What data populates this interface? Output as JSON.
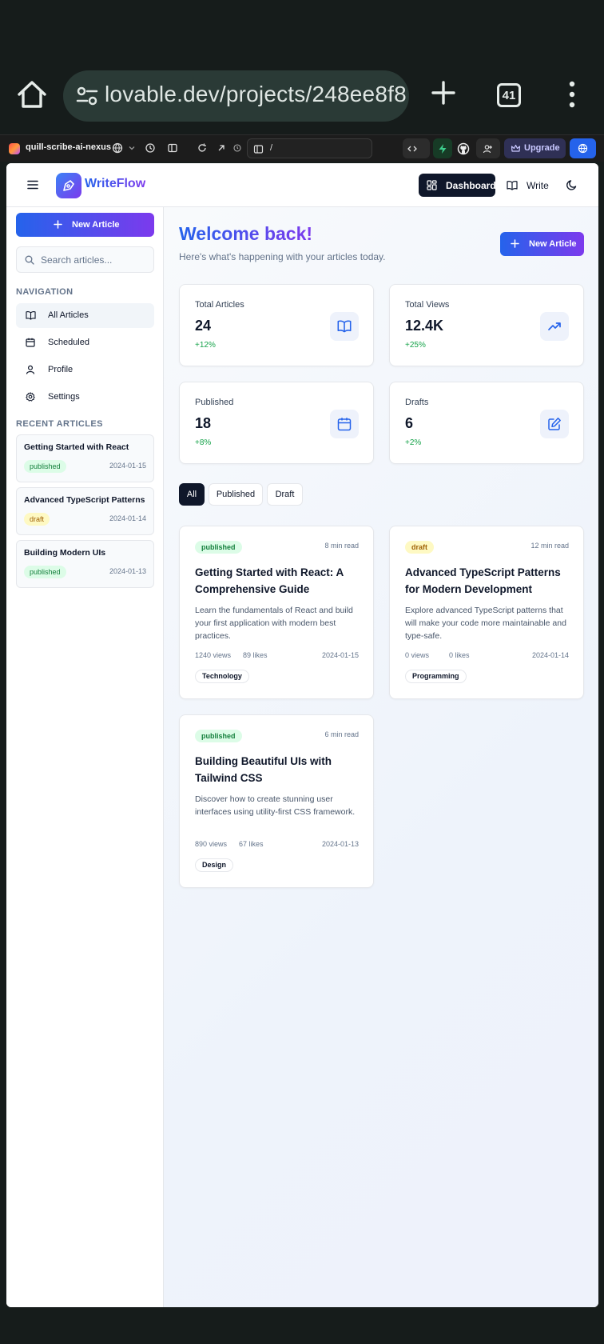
{
  "browser": {
    "url": "lovable.dev/projects/248ee8f8",
    "tab_count": "41"
  },
  "lovable": {
    "project_name": "quill-scribe-ai-nexus",
    "path": "/",
    "upgrade_label": "Upgrade"
  },
  "app": {
    "brand": "WriteFlow",
    "nav_dashboard": "Dashboard",
    "nav_write": "Write"
  },
  "sidebar": {
    "new_article_label": "New Article",
    "search_placeholder": "Search articles...",
    "navigation_heading": "NAVIGATION",
    "items": [
      {
        "label": "All Articles",
        "icon": "book-open-icon"
      },
      {
        "label": "Scheduled",
        "icon": "calendar-icon"
      },
      {
        "label": "Profile",
        "icon": "user-icon"
      },
      {
        "label": "Settings",
        "icon": "gear-icon"
      }
    ],
    "recent_heading": "RECENT ARTICLES",
    "recent": [
      {
        "title": "Getting Started with React",
        "status": "published",
        "date": "2024-01-15"
      },
      {
        "title": "Advanced TypeScript Patterns",
        "status": "draft",
        "date": "2024-01-14"
      },
      {
        "title": "Building Modern UIs",
        "status": "published",
        "date": "2024-01-13"
      }
    ]
  },
  "main": {
    "welcome": "Welcome back!",
    "subtitle": "Here's what's happening with your articles today.",
    "new_article_label": "New Article",
    "stats": [
      {
        "label": "Total Articles",
        "value": "24",
        "change": "+12%",
        "icon": "book-open-icon"
      },
      {
        "label": "Total Views",
        "value": "12.4K",
        "change": "+25%",
        "icon": "trending-up-icon"
      },
      {
        "label": "Published",
        "value": "18",
        "change": "+8%",
        "icon": "calendar-icon"
      },
      {
        "label": "Drafts",
        "value": "6",
        "change": "+2%",
        "icon": "edit-icon"
      }
    ],
    "filters": [
      "All",
      "Published",
      "Draft"
    ],
    "articles": [
      {
        "status": "published",
        "read_time": "8 min read",
        "title": "Getting Started with React: A Comprehensive Guide",
        "excerpt": "Learn the fundamentals of React and build your first application with modern best practices.",
        "views": "1240 views",
        "likes": "89 likes",
        "date": "2024-01-15",
        "tag": "Technology"
      },
      {
        "status": "draft",
        "read_time": "12 min read",
        "title": "Advanced TypeScript Patterns for Modern Development",
        "excerpt": "Explore advanced TypeScript patterns that will make your code more maintainable and type-safe.",
        "views": "0 views",
        "likes": "0 likes",
        "date": "2024-01-14",
        "tag": "Programming"
      },
      {
        "status": "published",
        "read_time": "6 min read",
        "title": "Building Beautiful UIs with Tailwind CSS",
        "excerpt": "Discover how to create stunning user interfaces using utility-first CSS framework.",
        "views": "890 views",
        "likes": "67 likes",
        "date": "2024-01-13",
        "tag": "Design"
      }
    ]
  },
  "colors": {
    "accent_start": "#2563eb",
    "accent_end": "#7c3aed",
    "published_bg": "#dcfce7",
    "draft_bg": "#fef9c3"
  }
}
